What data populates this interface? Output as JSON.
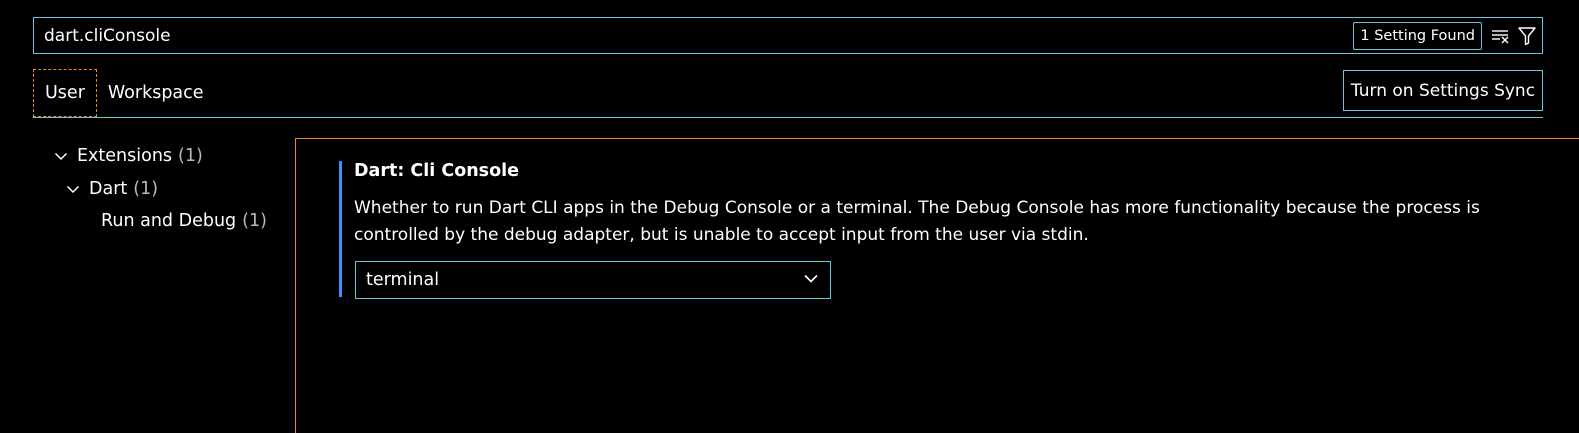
{
  "search": {
    "value": "dart.cliConsole",
    "result_count": "1 Setting Found",
    "clear_icon": "clear-filter-icon",
    "filter_icon": "filter-icon"
  },
  "tabs": [
    {
      "label": "User",
      "active": true
    },
    {
      "label": "Workspace",
      "active": false
    }
  ],
  "sync_button": "Turn on Settings Sync",
  "tree": [
    {
      "label": "Extensions",
      "count": "(1)"
    },
    {
      "label": "Dart",
      "count": "(1)"
    },
    {
      "label": "Run and Debug",
      "count": "(1)"
    }
  ],
  "setting": {
    "title": "Dart: Cli Console",
    "description": "Whether to run Dart CLI apps in the Debug Console or a terminal. The Debug Console has more functionality because the process is controlled by the debug adapter, but is unable to accept input from the user via stdin.",
    "selected_value": "terminal"
  },
  "colors": {
    "focus_border": "#6fc3df",
    "active_border": "#f38518",
    "modified_indicator": "#3794ff"
  }
}
